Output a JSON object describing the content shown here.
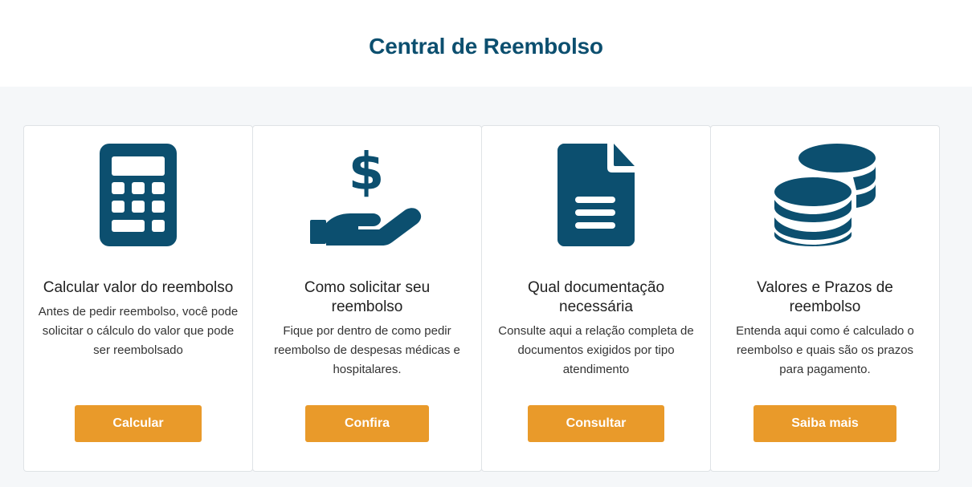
{
  "header": {
    "title": "Central de Reembolso"
  },
  "theme": {
    "primary": "#0c4f6f",
    "accent": "#e99a2a",
    "background": "#f5f7f9"
  },
  "cards": [
    {
      "icon": "calculator-icon",
      "title": "Calcular valor do reembolso",
      "description": "Antes de pedir reembolso, você pode solicitar o cálculo do valor que pode ser reembolsado",
      "button": "Calcular"
    },
    {
      "icon": "hand-money-icon",
      "title": "Como solicitar seu reembolso",
      "description": "Fique por dentro de como pedir reembolso de despesas médicas e hospitalares.",
      "button": "Confira"
    },
    {
      "icon": "document-icon",
      "title": "Qual documentação necessária",
      "description": "Consulte aqui a relação completa de documentos exigidos por tipo atendimento",
      "button": "Consultar"
    },
    {
      "icon": "coins-icon",
      "title": "Valores e Prazos de reembolso",
      "description": "Entenda aqui como é calculado o reembolso e quais são os prazos para pagamento.",
      "button": "Saiba mais"
    }
  ]
}
